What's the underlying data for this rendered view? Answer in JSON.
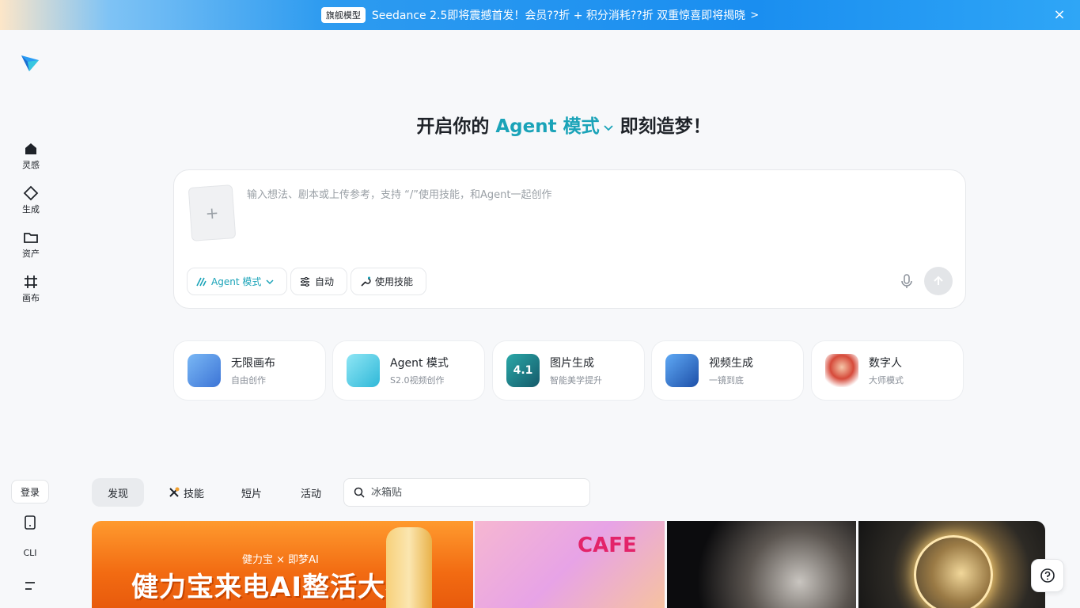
{
  "banner": {
    "tag": "旗舰模型",
    "text": "Seedance 2.5即将震撼首发！会员??折 + 积分消耗??折 双重惊喜即将揭晓",
    "chevron": ">",
    "close": "×"
  },
  "sidebar": {
    "items": [
      {
        "label": "灵感",
        "icon": "home-icon"
      },
      {
        "label": "生成",
        "icon": "diamond-icon"
      },
      {
        "label": "资产",
        "icon": "folder-icon"
      },
      {
        "label": "画布",
        "icon": "grid-hash-icon"
      }
    ],
    "login": "登录",
    "cli": "CLI"
  },
  "headline": {
    "prefix": "开启你的",
    "mode": "Agent 模式",
    "suffix": "即刻造梦！"
  },
  "prompt": {
    "upload_plus": "+",
    "placeholder": "输入想法、剧本或上传参考，支持 “/”使用技能，和Agent一起创作",
    "chips": {
      "agent": "Agent 模式",
      "auto": "自动",
      "skill": "使用技能"
    }
  },
  "cards": [
    {
      "title": "无限画布",
      "subtitle": "自由创作"
    },
    {
      "title": "Agent 模式",
      "subtitle": "S2.0视频创作"
    },
    {
      "title": "图片生成",
      "subtitle": "智能美学提升",
      "badge": "4.1"
    },
    {
      "title": "视频生成",
      "subtitle": "一镜到底"
    },
    {
      "title": "数字人",
      "subtitle": "大师模式"
    }
  ],
  "tabs": [
    {
      "label": "发现"
    },
    {
      "label": "技能"
    },
    {
      "label": "短片"
    },
    {
      "label": "活动"
    }
  ],
  "search": {
    "placeholder": "冰箱贴"
  },
  "gallery": {
    "g1_text": "健力宝来电AI整活大赛",
    "g1_brand": "健力宝 × 即梦AI",
    "g2_text": "CAFE"
  },
  "colors": {
    "accent": "#1aa3b8",
    "banner": "#1a8ef0"
  }
}
